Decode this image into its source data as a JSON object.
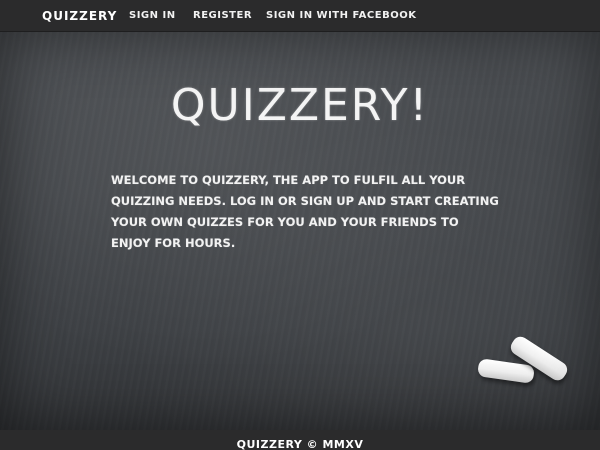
{
  "navbar": {
    "brand": "QUIZZERY",
    "links": {
      "sign_in": "SIGN IN",
      "register": "REGISTER",
      "sign_in_facebook": "SIGN IN WITH FACEBOOK"
    }
  },
  "hero": {
    "title": "QUIZZERY!",
    "welcome": "WELCOME TO QUIZZERY, THE APP TO FULFIL ALL YOUR QUIZZING NEEDS. LOG IN OR SIGN UP AND START CREATING YOUR OWN QUIZZES FOR YOU AND YOUR FRIENDS TO ENJOY FOR HOURS."
  },
  "footer": {
    "text": "QUIZZERY © MMXV"
  },
  "colors": {
    "navbar_bg": "#2b2b2c",
    "board_bg": "#45484c",
    "text": "#ffffff"
  }
}
